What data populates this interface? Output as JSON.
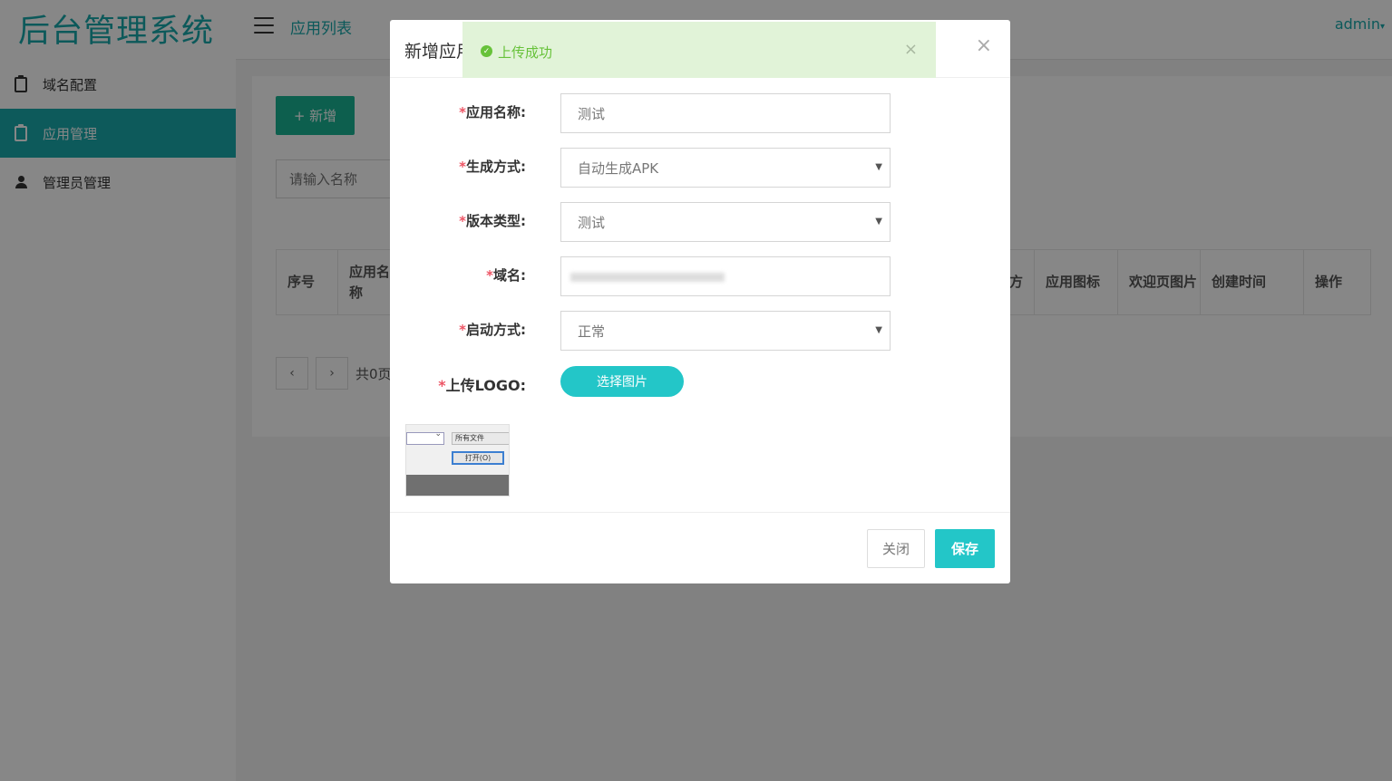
{
  "app": {
    "brand": "后台管理系统",
    "user": "admin"
  },
  "sidebar": {
    "items": [
      {
        "label": "域名配置",
        "icon": "clipboard-icon",
        "active": false
      },
      {
        "label": "应用管理",
        "icon": "clipboard-icon",
        "active": true
      },
      {
        "label": "管理员管理",
        "icon": "user-icon",
        "active": false
      }
    ]
  },
  "header": {
    "breadcrumb": "应用列表",
    "menu_icon": "hamburger-icon"
  },
  "toolbar": {
    "add_label": "+ 新增",
    "search_placeholder": "请输入名称"
  },
  "table": {
    "columns": [
      "序号",
      "应用名称",
      "方",
      "应用图标",
      "欢迎页图片",
      "创建时间",
      "操作"
    ]
  },
  "pagination": {
    "prev": "‹",
    "next": "›",
    "total_text": "共0页"
  },
  "modal": {
    "title": "新增应用",
    "toast": {
      "text": "上传成功",
      "icon": "check-circle-icon",
      "color": "#67c23a"
    },
    "fields": {
      "app_name": {
        "label": "应用名称",
        "value": "测试"
      },
      "generate_mode": {
        "label": "生成方式",
        "value": "自动生成APK"
      },
      "version_type": {
        "label": "版本类型",
        "value": "测试"
      },
      "domain": {
        "label": "域名",
        "value": ""
      },
      "launch_mode": {
        "label": "启动方式",
        "value": "正常"
      },
      "logo": {
        "label": "上传LOGO",
        "button": "选择图片"
      }
    },
    "preview": {
      "filter_text": "所有文件",
      "open_text": "打开(O)"
    },
    "footer": {
      "cancel": "关闭",
      "save": "保存"
    }
  },
  "colors": {
    "brand": "#18a8ab",
    "active_nav": "#19aaac",
    "primary_button": "#23c6c8",
    "add_button": "#1ab394",
    "required_star": "#ed5565"
  }
}
